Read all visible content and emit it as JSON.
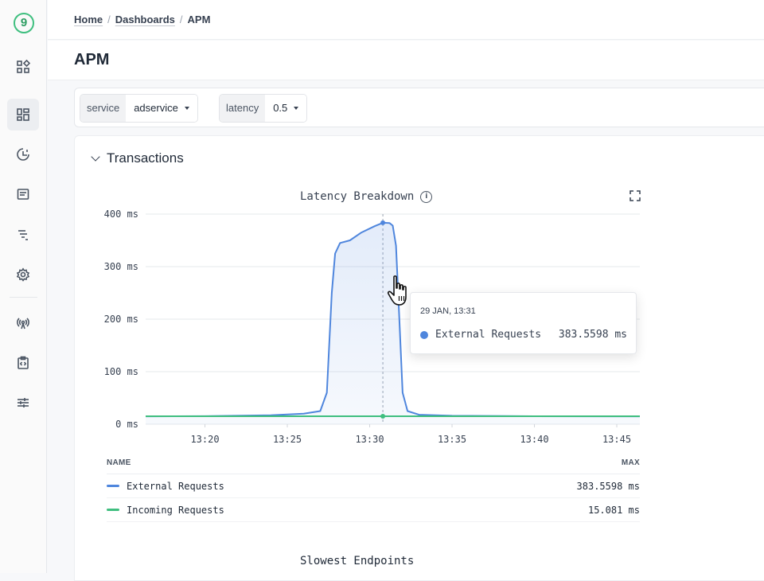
{
  "app": {
    "logo_text": "9"
  },
  "sidebar": {
    "items": [
      {
        "icon": "apps-icon"
      },
      {
        "icon": "dashboards-icon",
        "active": true
      },
      {
        "icon": "alerts-icon"
      },
      {
        "icon": "logs-icon"
      },
      {
        "icon": "traces-icon"
      },
      {
        "icon": "settings-gear-icon"
      },
      {
        "icon": "broadcast-icon"
      },
      {
        "icon": "code-clipboard-icon"
      },
      {
        "icon": "sliders-icon"
      }
    ]
  },
  "breadcrumb": {
    "home": "Home",
    "dashboards": "Dashboards",
    "current": "APM",
    "separator": "/"
  },
  "page": {
    "title": "APM"
  },
  "filters": [
    {
      "label": "service",
      "value": "adservice"
    },
    {
      "label": "latency",
      "value": "0.5"
    }
  ],
  "section": {
    "title": "Transactions"
  },
  "chart_data": {
    "type": "area",
    "title": "Latency Breakdown",
    "y_tick_labels": [
      "400 ms",
      "300 ms",
      "200 ms",
      "100 ms",
      "0 ms"
    ],
    "ylim": [
      0,
      400
    ],
    "x_tick_labels": [
      "13:20",
      "13:25",
      "13:30",
      "13:35",
      "13:40",
      "13:45"
    ],
    "x_unit_note": "minutes after 13:00",
    "xlim": [
      16.4,
      46.4
    ],
    "grid": true,
    "series": [
      {
        "name": "External Requests",
        "color": "#4f86dd",
        "fill": true,
        "points": [
          [
            16.4,
            15
          ],
          [
            20,
            15.3
          ],
          [
            24,
            17
          ],
          [
            26,
            20
          ],
          [
            27,
            25
          ],
          [
            27.4,
            60
          ],
          [
            27.7,
            250
          ],
          [
            27.9,
            325
          ],
          [
            28.2,
            345
          ],
          [
            28.8,
            350
          ],
          [
            29.5,
            365
          ],
          [
            30.3,
            377
          ],
          [
            30.8,
            383.5598
          ],
          [
            31.2,
            383
          ],
          [
            31.4,
            378
          ],
          [
            31.6,
            340
          ],
          [
            31.8,
            200
          ],
          [
            32,
            60
          ],
          [
            32.3,
            25
          ],
          [
            33,
            18
          ],
          [
            35,
            16
          ],
          [
            40,
            15.2
          ],
          [
            46.4,
            15
          ]
        ]
      },
      {
        "name": "Incoming Requests",
        "color": "#3fbe7f",
        "fill": false,
        "points": [
          [
            16.4,
            15.081
          ],
          [
            30.8,
            15.081
          ],
          [
            46.4,
            15.081
          ]
        ]
      }
    ],
    "crosshair_x": 30.8
  },
  "tooltip": {
    "time": "29 JAN, 13:31",
    "series_name": "External Requests",
    "value": "383.5598 ms"
  },
  "legend": {
    "name_header": "NAME",
    "max_header": "MAX",
    "rows": [
      {
        "name": "External Requests",
        "max": "383.5598 ms",
        "color": "#4f86dd"
      },
      {
        "name": "Incoming Requests",
        "max": "15.081 ms",
        "color": "#3fbe7f"
      }
    ]
  },
  "next_chart": {
    "title": "Slowest Endpoints"
  }
}
